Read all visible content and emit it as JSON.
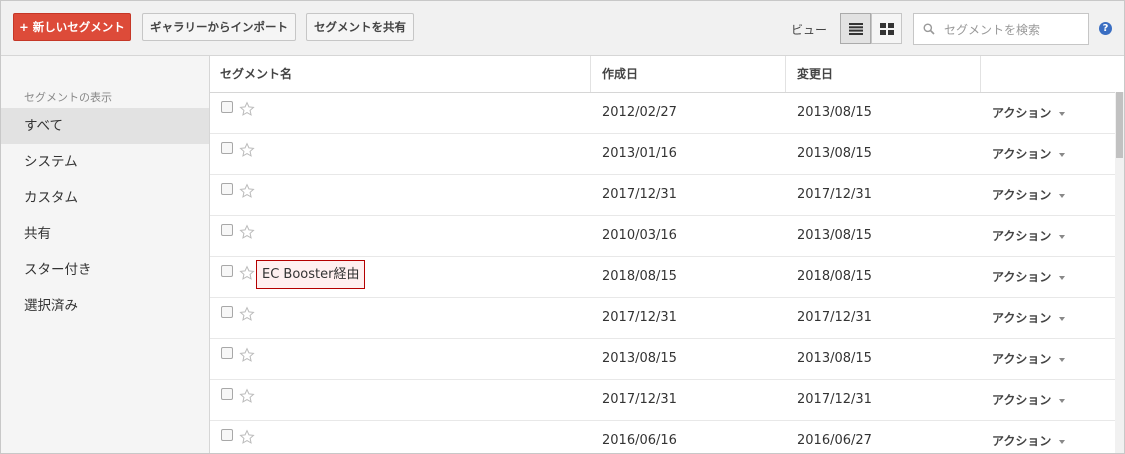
{
  "toolbar": {
    "new_segment_label": "+ 新しいセグメント",
    "import_label": "ギャラリーからインポート",
    "share_label": "セグメントを共有",
    "view_label": "ビュー",
    "search_placeholder": "セグメントを検索",
    "help_label": "?"
  },
  "sidebar": {
    "title": "セグメントの表示",
    "items": [
      {
        "label": "すべて",
        "active": true
      },
      {
        "label": "システム",
        "active": false
      },
      {
        "label": "カスタム",
        "active": false
      },
      {
        "label": "共有",
        "active": false
      },
      {
        "label": "スター付き",
        "active": false
      },
      {
        "label": "選択済み",
        "active": false
      }
    ]
  },
  "table": {
    "headers": {
      "name": "セグメント名",
      "created": "作成日",
      "modified": "変更日"
    },
    "action_label": "アクション",
    "rows": [
      {
        "name": "",
        "created": "2012/02/27",
        "modified": "2013/08/15",
        "highlight": false
      },
      {
        "name": "",
        "created": "2013/01/16",
        "modified": "2013/08/15",
        "highlight": false
      },
      {
        "name": "",
        "created": "2017/12/31",
        "modified": "2017/12/31",
        "highlight": false
      },
      {
        "name": "",
        "created": "2010/03/16",
        "modified": "2013/08/15",
        "highlight": false
      },
      {
        "name": "EC Booster経由",
        "created": "2018/08/15",
        "modified": "2018/08/15",
        "highlight": true
      },
      {
        "name": "",
        "created": "2017/12/31",
        "modified": "2017/12/31",
        "highlight": false
      },
      {
        "name": "",
        "created": "2013/08/15",
        "modified": "2013/08/15",
        "highlight": false
      },
      {
        "name": "",
        "created": "2017/12/31",
        "modified": "2017/12/31",
        "highlight": false
      },
      {
        "name": "",
        "created": "2016/06/16",
        "modified": "2016/06/27",
        "highlight": false
      }
    ]
  },
  "colors": {
    "primary_button": "#dd4b39",
    "highlight_border": "#b40000",
    "help_icon": "#3a6ec2"
  }
}
